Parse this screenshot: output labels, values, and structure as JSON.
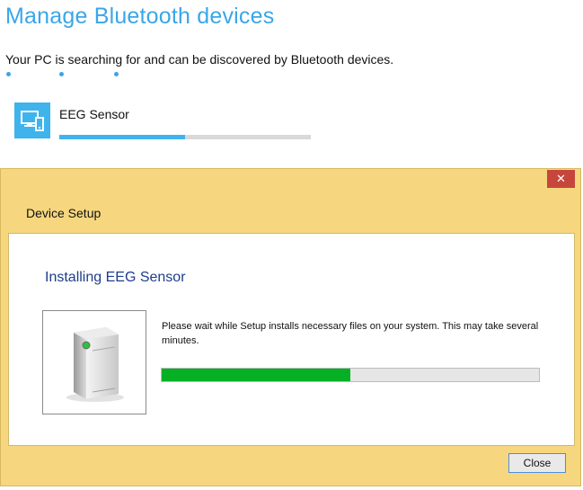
{
  "page": {
    "title": "Manage Bluetooth devices",
    "subtitle": "Your PC is searching for and can be discovered by Bluetooth devices."
  },
  "device": {
    "name": "EEG Sensor",
    "pairing_progress_percent": 50,
    "icon": "devices-icon"
  },
  "dialog": {
    "title": "Device Setup",
    "heading": "Installing EEG Sensor",
    "message": "Please wait while Setup installs necessary files on your system. This may take several minutes.",
    "install_progress_percent": 50,
    "close_button_label": "Close",
    "close_x": "✕",
    "device_image_icon": "tower-device-icon"
  },
  "colors": {
    "accent_blue": "#3aa6e8",
    "tile_blue": "#3fb3ec",
    "dialog_frame": "#f6d77f",
    "close_red": "#c7463c",
    "install_green": "#06b025",
    "heading_blue": "#1e3d8a"
  }
}
